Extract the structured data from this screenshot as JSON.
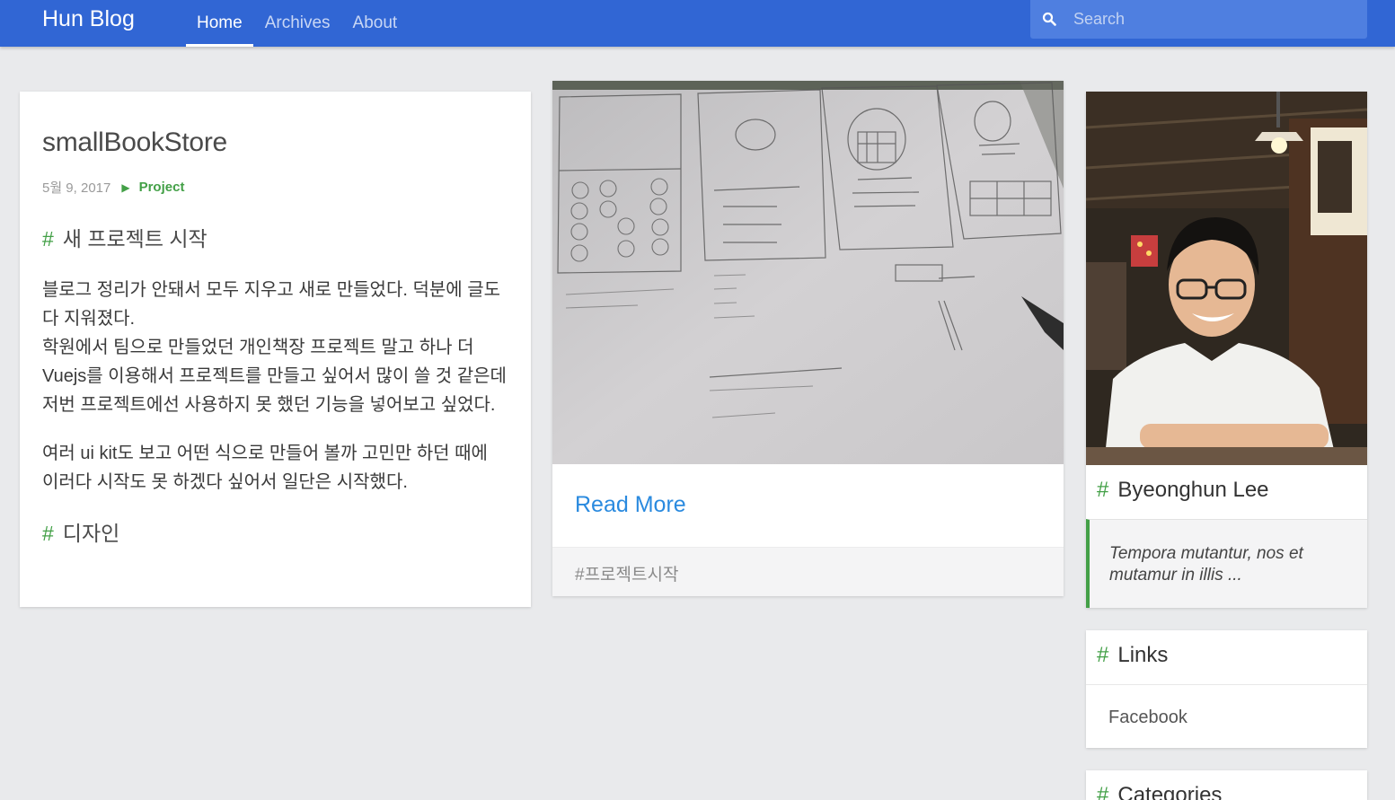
{
  "header": {
    "brand": "Hun Blog",
    "nav": [
      {
        "label": "Home",
        "active": true
      },
      {
        "label": "Archives",
        "active": false
      },
      {
        "label": "About",
        "active": false
      }
    ],
    "search": {
      "placeholder": "Search",
      "icon": "search-icon"
    }
  },
  "post": {
    "title": "smallBookStore",
    "date": "5월 9, 2017",
    "category": "Project",
    "sections": [
      {
        "heading": "새 프로젝트 시작"
      },
      {
        "heading": "디자인"
      }
    ],
    "paragraphs": [
      "블로그 정리가 안돼서 모두 지우고 새로 만들었다. 덕분에 글도 다 지워졌다.",
      "학원에서 팀으로 만들었던 개인책장 프로젝트 말고 하나 더 Vuejs를 이용해서 프로젝트를 만들고 싶어서 많이 쓸 것 같은데 저번 프로젝트에선 사용하지 못 했던 기능을 넣어보고 싶었다.",
      "여러 ui kit도 보고 어떤 식으로 만들어 볼까 고민만 하던 때에 이러다 시작도 못 하겠다 싶어서 일단은 시작했다."
    ]
  },
  "feature": {
    "read_more": "Read More",
    "tag": "#프로젝트시작"
  },
  "sidebar": {
    "profile": {
      "name": "Byeonghun Lee",
      "quote": "Tempora mutantur, nos et mutamur in illis ..."
    },
    "links": {
      "title": "Links",
      "items": [
        "Facebook"
      ]
    },
    "categories": {
      "title": "Categories"
    }
  },
  "colors": {
    "header": "#3166d4",
    "accent": "#43a047",
    "link": "#2a8adf",
    "background": "#e9eaec"
  }
}
